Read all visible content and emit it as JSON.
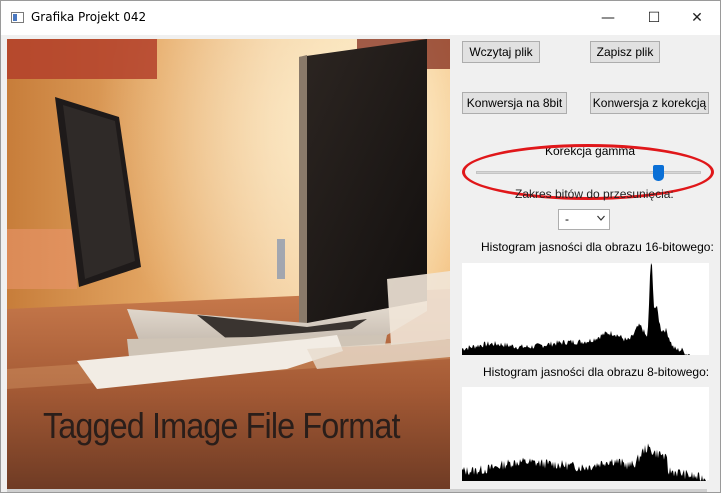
{
  "window": {
    "title": "Grafika Projekt 042"
  },
  "titlebar": {
    "minimize_glyph": "—",
    "maximize_glyph": "☐",
    "close_glyph": "✕"
  },
  "image": {
    "caption": "Tagged Image File Format"
  },
  "buttons": {
    "load": "Wczytaj plik",
    "save": "Zapisz plik",
    "convert8": "Konwersja na 8bit",
    "convert_corr": "Konwersja z korekcją"
  },
  "gamma": {
    "label": "Korekcja gamma",
    "value": 0.81
  },
  "bits": {
    "label": "Zakres bitów do przesunięcia:",
    "selected": "-"
  },
  "histograms": {
    "h16_label": "Histogram jasności dla obrazu 16-bitowego:",
    "h8_label": "Histogram jasności dla obrazu 8-bitowego:"
  },
  "colors": {
    "accent": "#0a6fd6",
    "annotation": "#e0171a",
    "background": "#f0f0f0"
  },
  "icons": {
    "app": "app-window-icon",
    "chevron": "chevron-down-icon"
  }
}
